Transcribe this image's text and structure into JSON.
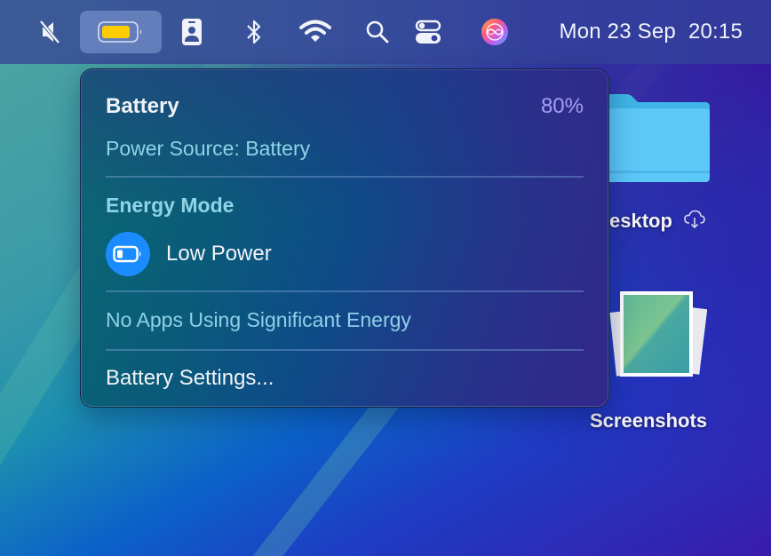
{
  "menubar": {
    "items": [
      {
        "name": "sound-muted",
        "label": "Sound muted"
      },
      {
        "name": "battery",
        "label": "Battery",
        "active": true
      },
      {
        "name": "contact-card",
        "label": "Contact card"
      },
      {
        "name": "bluetooth",
        "label": "Bluetooth"
      },
      {
        "name": "wifi",
        "label": "Wi-Fi"
      },
      {
        "name": "spotlight",
        "label": "Spotlight"
      },
      {
        "name": "control-center",
        "label": "Control Center"
      },
      {
        "name": "siri",
        "label": "Siri"
      }
    ],
    "date": "Mon 23 Sep",
    "time": "20:15",
    "battery_fill_color": "#ffcc00"
  },
  "battery_popover": {
    "title": "Battery",
    "percent": "80%",
    "power_source": "Power Source: Battery",
    "energy_mode_header": "Energy Mode",
    "energy_mode": "Low Power",
    "apps_status": "No Apps Using Significant Energy",
    "settings_label": "Battery Settings...",
    "accent_color": "#1a8cff",
    "percent_color": "#a79cf2"
  },
  "desktop": {
    "icons": [
      {
        "name": "Desktop",
        "label": "esktop",
        "icloud": true
      },
      {
        "name": "Screenshots",
        "label": "Screenshots"
      }
    ]
  }
}
